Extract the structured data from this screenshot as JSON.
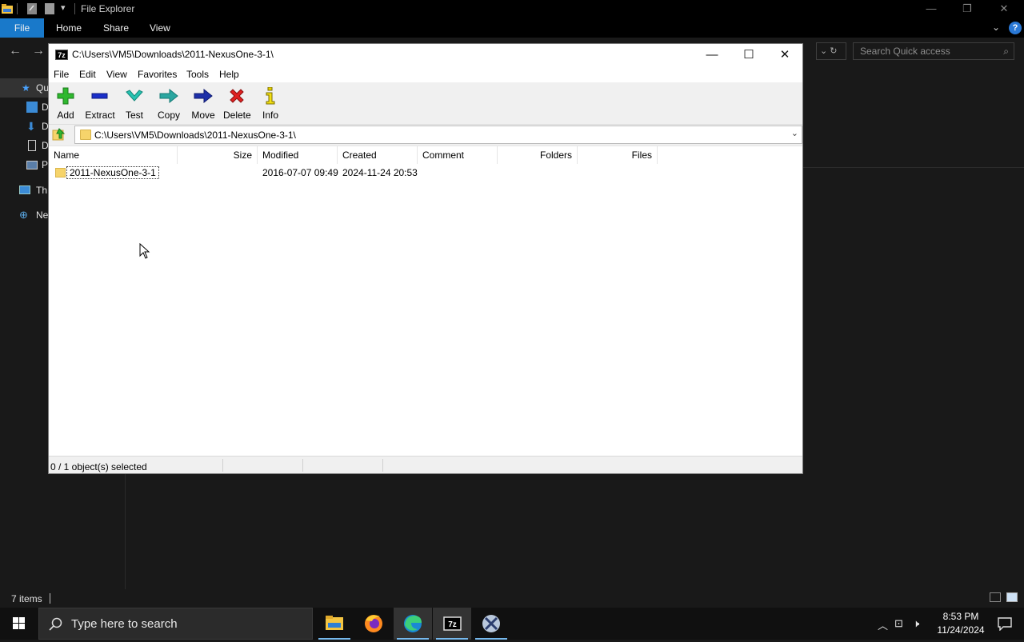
{
  "explorer": {
    "title": "File Explorer",
    "ribbon_tabs": [
      "File",
      "Home",
      "Share",
      "View"
    ],
    "search_placeholder": "Search Quick access",
    "nav_items": [
      "Qu",
      "D",
      "D",
      "D",
      "P",
      "Th",
      "Ne"
    ],
    "status_items": "7 items"
  },
  "zip": {
    "title": "C:\\Users\\VM5\\Downloads\\2011-NexusOne-3-1\\",
    "logo": "7z",
    "menu": [
      "File",
      "Edit",
      "View",
      "Favorites",
      "Tools",
      "Help"
    ],
    "toolbar": [
      "Add",
      "Extract",
      "Test",
      "Copy",
      "Move",
      "Delete",
      "Info"
    ],
    "address": "C:\\Users\\VM5\\Downloads\\2011-NexusOne-3-1\\",
    "columns": [
      "Name",
      "Size",
      "Modified",
      "Created",
      "Comment",
      "Folders",
      "Files"
    ],
    "rows": [
      {
        "name": "2011-NexusOne-3-1",
        "size": "",
        "modified": "2016-07-07 09:49",
        "created": "2024-11-24 20:53",
        "comment": "",
        "folders": "",
        "files": ""
      }
    ],
    "status": "0 / 1 object(s) selected"
  },
  "taskbar": {
    "search_placeholder": "Type here to search",
    "apps": [
      "file-explorer",
      "firefox",
      "edge",
      "7-zip",
      "tool"
    ],
    "time": "8:53 PM",
    "date": "11/24/2024"
  },
  "colors": {
    "accent": "#1979ca",
    "taskbar": "#101010",
    "explorer_bg": "#191919"
  }
}
